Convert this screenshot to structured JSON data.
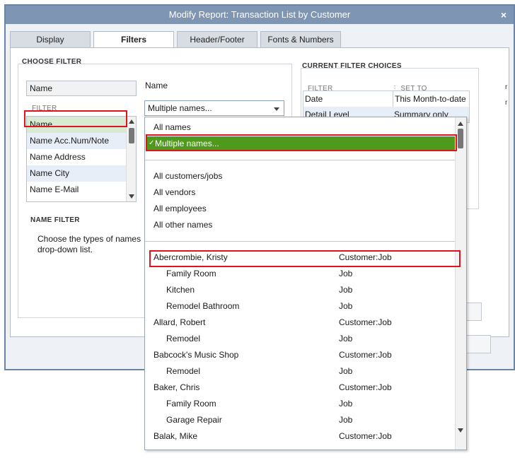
{
  "window": {
    "title": "Modify Report: Transaction List by Customer",
    "close_glyph": "×"
  },
  "tabs": [
    "Display",
    "Filters",
    "Header/Footer",
    "Fonts & Numbers"
  ],
  "choose_filter": {
    "heading": "CHOOSE FILTER",
    "search_value": "Name",
    "filter_sublabel": "FILTER",
    "items": [
      "Name",
      "Name Acc.Num/Note",
      "Name Address",
      "Name City",
      "Name E-Mail"
    ]
  },
  "name_field": {
    "label": "Name",
    "selected": "Multiple names..."
  },
  "name_filter": {
    "heading": "NAME FILTER",
    "description": "Choose the types of names\ndrop-down list."
  },
  "current_filters": {
    "heading": "CURRENT FILTER CHOICES",
    "col_filter": "FILTER",
    "col_set_to": "SET TO",
    "rows": [
      {
        "filter": "Date",
        "set_to": "This Month-to-date"
      },
      {
        "filter": "Detail Level",
        "set_to": "Summary only"
      }
    ]
  },
  "popup": {
    "top_options": [
      "All names",
      "Multiple names..."
    ],
    "check_glyph": "✓",
    "type_options": [
      "All customers/jobs",
      "All vendors",
      "All employees",
      "All other names"
    ],
    "names": [
      {
        "name": "Abercrombie, Kristy",
        "type": "Customer:Job",
        "indent": false
      },
      {
        "name": "Family Room",
        "type": "Job",
        "indent": true
      },
      {
        "name": "Kitchen",
        "type": "Job",
        "indent": true
      },
      {
        "name": "Remodel Bathroom",
        "type": "Job",
        "indent": true
      },
      {
        "name": "Allard, Robert",
        "type": "Customer:Job",
        "indent": false
      },
      {
        "name": "Remodel",
        "type": "Job",
        "indent": true
      },
      {
        "name": "Babcock's Music Shop",
        "type": "Customer:Job",
        "indent": false
      },
      {
        "name": "Remodel",
        "type": "Job",
        "indent": true
      },
      {
        "name": "Baker, Chris",
        "type": "Customer:Job",
        "indent": false
      },
      {
        "name": "Family Room",
        "type": "Job",
        "indent": true
      },
      {
        "name": "Garage Repair",
        "type": "Job",
        "indent": true
      },
      {
        "name": "Balak, Mike",
        "type": "Customer:Job",
        "indent": false
      }
    ]
  },
  "colors": {
    "highlight_green": "#4f9a1c",
    "annotation_red": "#e0141e",
    "title_bar": "#7e95b3"
  }
}
